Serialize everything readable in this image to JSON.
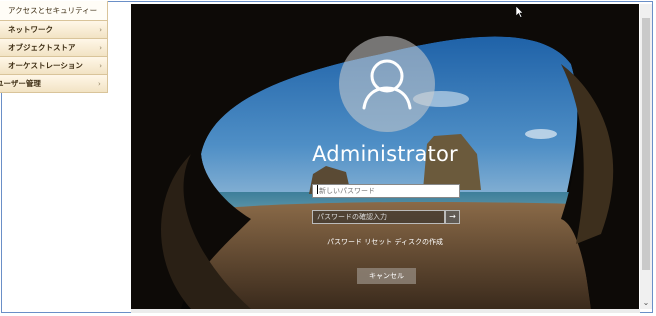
{
  "menu": {
    "items": [
      {
        "label": "アクセスとセキュリティー",
        "chevron": false
      },
      {
        "label": "ネットワーク",
        "chevron": true
      },
      {
        "label": "オブジェクトストア",
        "chevron": true
      },
      {
        "label": "オーケストレーション",
        "chevron": true
      },
      {
        "label": "ユーザー管理",
        "chevron": true
      }
    ],
    "chevron_icon": "chevron-right-icon"
  },
  "login": {
    "username": "Administrator",
    "new_password_placeholder": "新しいパスワード",
    "confirm_password_placeholder": "パスワードの確認入力",
    "submit_icon": "arrow-right-icon",
    "reset_link": "パスワード リセット ディスクの作成",
    "cancel_label": "キャンセル",
    "avatar_icon": "user-icon"
  },
  "colors": {
    "menu_bg": "#f2e3c4",
    "frame_border": "#6a8fc7",
    "screen_bg": "#070605"
  }
}
